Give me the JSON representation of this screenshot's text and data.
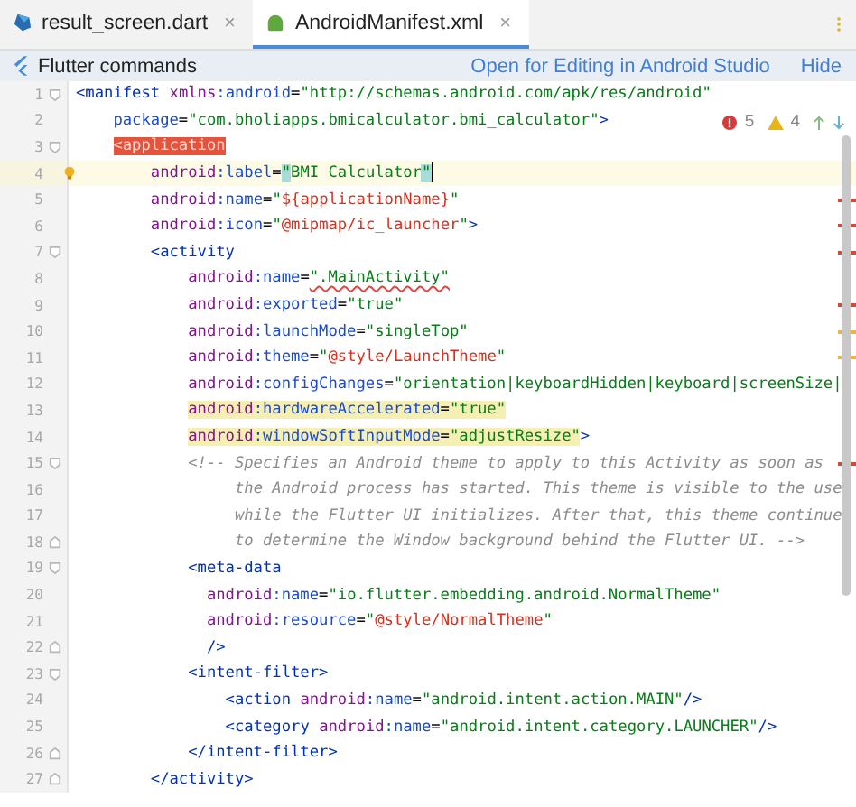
{
  "tabs": [
    {
      "label": "result_screen.dart",
      "kind": "dart",
      "selected": false,
      "close": "×"
    },
    {
      "label": "AndroidManifest.xml",
      "kind": "android",
      "selected": true,
      "close": "×"
    }
  ],
  "banner": {
    "title": "Flutter commands",
    "links": [
      "Open for Editing in Android Studio",
      "Hide"
    ]
  },
  "inspections": {
    "errors": "5",
    "warnings": "4"
  },
  "lines": [
    {
      "number": "1",
      "fold_start": true,
      "tokens": [
        {
          "kind": "tag",
          "text": "<manifest"
        },
        {
          "kind": "ns",
          "text": " xmlns"
        },
        {
          "kind": "attr",
          "text": ":android"
        },
        {
          "kind": "plain",
          "text": "="
        },
        {
          "kind": "str",
          "text": "\"http://schemas.android.com/apk/res/android\""
        }
      ]
    },
    {
      "number": "2",
      "tokens": [
        {
          "kind": "attr",
          "text": "    package"
        },
        {
          "kind": "plain",
          "text": "="
        },
        {
          "kind": "str",
          "text": "\"com.bholiapps.bmicalculator.bmi_calculator\""
        },
        {
          "kind": "tag",
          "text": ">"
        }
      ]
    },
    {
      "number": "3",
      "fold_start": true,
      "tokens": [
        {
          "kind": "tag",
          "text": "    <application",
          "error": true
        }
      ]
    },
    {
      "number": "4",
      "current": true,
      "bulb": true,
      "caret": true,
      "tokens": [
        {
          "kind": "ns",
          "text": "        android"
        },
        {
          "kind": "attr",
          "text": ":label"
        },
        {
          "kind": "plain",
          "text": "="
        },
        {
          "kind": "str",
          "text": "\"",
          "matched": true
        },
        {
          "kind": "str",
          "text": "BMI Calculator"
        },
        {
          "kind": "str",
          "text": "\"",
          "matched": true
        }
      ]
    },
    {
      "number": "5",
      "error_stripe": true,
      "tokens": [
        {
          "kind": "ns",
          "text": "        android"
        },
        {
          "kind": "attr",
          "text": ":name"
        },
        {
          "kind": "plain",
          "text": "="
        },
        {
          "kind": "str",
          "text": "\""
        },
        {
          "kind": "ref",
          "text": "${applicationName}"
        },
        {
          "kind": "str",
          "text": "\""
        }
      ]
    },
    {
      "number": "6",
      "error_stripe": true,
      "tokens": [
        {
          "kind": "ns",
          "text": "        android"
        },
        {
          "kind": "attr",
          "text": ":icon"
        },
        {
          "kind": "plain",
          "text": "="
        },
        {
          "kind": "str",
          "text": "\""
        },
        {
          "kind": "ref",
          "text": "@mipmap/ic_launcher"
        },
        {
          "kind": "str",
          "text": "\""
        },
        {
          "kind": "tag",
          "text": ">"
        }
      ]
    },
    {
      "number": "7",
      "fold_start": true,
      "error_stripe": true,
      "tokens": [
        {
          "kind": "tag",
          "text": "        <activity"
        }
      ]
    },
    {
      "number": "8",
      "tokens": [
        {
          "kind": "ns",
          "text": "            android"
        },
        {
          "kind": "attr",
          "text": ":name"
        },
        {
          "kind": "plain",
          "text": "="
        },
        {
          "kind": "str",
          "text": "\".MainActivity\"",
          "typo": true
        }
      ]
    },
    {
      "number": "9",
      "error_stripe": true,
      "tokens": [
        {
          "kind": "ns",
          "text": "            android"
        },
        {
          "kind": "attr",
          "text": ":exported"
        },
        {
          "kind": "plain",
          "text": "="
        },
        {
          "kind": "str",
          "text": "\"true\""
        }
      ]
    },
    {
      "number": "10",
      "warning_stripe": true,
      "tokens": [
        {
          "kind": "ns",
          "text": "            android"
        },
        {
          "kind": "attr",
          "text": ":launchMode"
        },
        {
          "kind": "plain",
          "text": "="
        },
        {
          "kind": "str",
          "text": "\"singleTop\""
        }
      ]
    },
    {
      "number": "11",
      "warning_stripe": true,
      "tokens": [
        {
          "kind": "ns",
          "text": "            android"
        },
        {
          "kind": "attr",
          "text": ":theme"
        },
        {
          "kind": "plain",
          "text": "="
        },
        {
          "kind": "str",
          "text": "\""
        },
        {
          "kind": "ref",
          "text": "@style/LaunchTheme"
        },
        {
          "kind": "str",
          "text": "\""
        }
      ]
    },
    {
      "number": "12",
      "tokens": [
        {
          "kind": "ns",
          "text": "            android"
        },
        {
          "kind": "attr",
          "text": ":configChanges"
        },
        {
          "kind": "plain",
          "text": "="
        },
        {
          "kind": "str",
          "text": "\"orientation|keyboardHidden|keyboard|screenSize|"
        }
      ]
    },
    {
      "number": "13",
      "tokens": [
        {
          "kind": "ns",
          "text": "            android",
          "warn": true
        },
        {
          "kind": "attr",
          "text": ":hardwareAccelerated",
          "warn": true
        },
        {
          "kind": "plain",
          "text": "=",
          "warn": true
        },
        {
          "kind": "str",
          "text": "\"true\"",
          "warn": true
        }
      ]
    },
    {
      "number": "14",
      "tokens": [
        {
          "kind": "ns",
          "text": "            android",
          "warn": true
        },
        {
          "kind": "attr",
          "text": ":windowSoftInputMode",
          "warn": true
        },
        {
          "kind": "plain",
          "text": "=",
          "warn": true
        },
        {
          "kind": "str",
          "text": "\"adjustResize\"",
          "warn": true
        },
        {
          "kind": "tag",
          "text": ">"
        }
      ]
    },
    {
      "number": "15",
      "fold_start": true,
      "error_stripe": true,
      "tokens": [
        {
          "kind": "comment",
          "text": "            <!-- Specifies an Android theme to apply to this Activity as soon as"
        }
      ]
    },
    {
      "number": "16",
      "tokens": [
        {
          "kind": "comment",
          "text": "                 the Android process has started. This theme is visible to the use"
        }
      ]
    },
    {
      "number": "17",
      "tokens": [
        {
          "kind": "comment",
          "text": "                 while the Flutter UI initializes. After that, this theme continue"
        }
      ]
    },
    {
      "number": "18",
      "fold_end": true,
      "tokens": [
        {
          "kind": "comment",
          "text": "                 to determine the Window background behind the Flutter UI. -->"
        }
      ]
    },
    {
      "number": "19",
      "fold_start": true,
      "tokens": [
        {
          "kind": "tag",
          "text": "            <meta-data"
        }
      ]
    },
    {
      "number": "20",
      "tokens": [
        {
          "kind": "ns",
          "text": "              android"
        },
        {
          "kind": "attr",
          "text": ":name"
        },
        {
          "kind": "plain",
          "text": "="
        },
        {
          "kind": "str",
          "text": "\"io.flutter.embedding.android.NormalTheme\""
        }
      ]
    },
    {
      "number": "21",
      "tokens": [
        {
          "kind": "ns",
          "text": "              android"
        },
        {
          "kind": "attr",
          "text": ":resource"
        },
        {
          "kind": "plain",
          "text": "="
        },
        {
          "kind": "str",
          "text": "\""
        },
        {
          "kind": "ref",
          "text": "@style/NormalTheme"
        },
        {
          "kind": "str",
          "text": "\""
        }
      ]
    },
    {
      "number": "22",
      "fold_end": true,
      "tokens": [
        {
          "kind": "tag",
          "text": "              />"
        }
      ]
    },
    {
      "number": "23",
      "fold_start": true,
      "tokens": [
        {
          "kind": "tag",
          "text": "            <intent-filter>"
        }
      ]
    },
    {
      "number": "24",
      "tokens": [
        {
          "kind": "tag",
          "text": "                <action"
        },
        {
          "kind": "ns",
          "text": " android"
        },
        {
          "kind": "attr",
          "text": ":name"
        },
        {
          "kind": "plain",
          "text": "="
        },
        {
          "kind": "str",
          "text": "\"android.intent.action.MAIN\""
        },
        {
          "kind": "tag",
          "text": "/>"
        }
      ]
    },
    {
      "number": "25",
      "tokens": [
        {
          "kind": "tag",
          "text": "                <category"
        },
        {
          "kind": "ns",
          "text": " android"
        },
        {
          "kind": "attr",
          "text": ":name"
        },
        {
          "kind": "plain",
          "text": "="
        },
        {
          "kind": "str",
          "text": "\"android.intent.category.LAUNCHER\""
        },
        {
          "kind": "tag",
          "text": "/>"
        }
      ]
    },
    {
      "number": "26",
      "fold_end": true,
      "tokens": [
        {
          "kind": "tag",
          "text": "            </intent-filter>"
        }
      ]
    },
    {
      "number": "27",
      "fold_end": true,
      "tokens": [
        {
          "kind": "tag",
          "text": "        </activity>"
        }
      ]
    }
  ]
}
